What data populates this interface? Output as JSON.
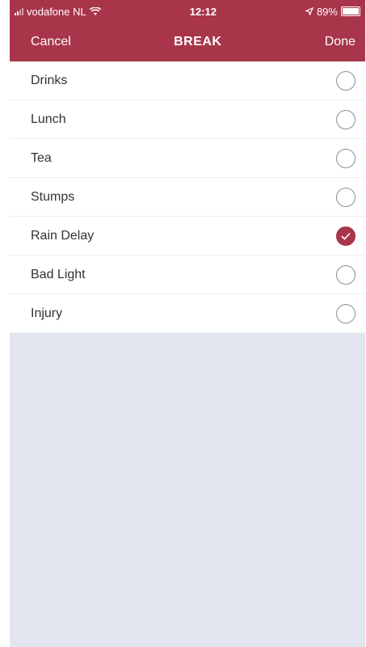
{
  "status_bar": {
    "carrier": "vodafone NL",
    "time": "12:12",
    "battery": "89%",
    "battery_level": 0.89
  },
  "nav": {
    "cancel_label": "Cancel",
    "title": "BREAK",
    "done_label": "Done"
  },
  "options": [
    {
      "label": "Drinks",
      "selected": false
    },
    {
      "label": "Lunch",
      "selected": false
    },
    {
      "label": "Tea",
      "selected": false
    },
    {
      "label": "Stumps",
      "selected": false
    },
    {
      "label": "Rain Delay",
      "selected": true
    },
    {
      "label": "Bad Light",
      "selected": false
    },
    {
      "label": "Injury",
      "selected": false
    }
  ],
  "colors": {
    "accent": "#a8354a",
    "background": "#e1e5ee"
  },
  "icons": {
    "signal": "cellular-signal-icon",
    "wifi": "wifi-icon",
    "location": "location-arrow-icon",
    "battery": "battery-icon",
    "check": "checkmark-icon"
  }
}
